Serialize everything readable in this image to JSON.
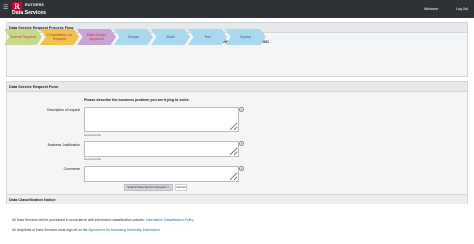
{
  "header": {
    "menu_icon": "hamburger-icon",
    "logo_letter": "R",
    "brand": "RUTGERS",
    "app_title": "Data Services",
    "nav": {
      "welcome": "Welcome",
      "logout": "Log Out"
    }
  },
  "process_panel": {
    "title": "Data Service Request Process Flow",
    "flow_title": "Data Service Request Process:",
    "steps": [
      {
        "label": "Submit Request",
        "state": "done"
      },
      {
        "label": "Consultation on Request",
        "state": "consult"
      },
      {
        "label": "Data Owner Approval",
        "state": "owner"
      },
      {
        "label": "Design",
        "state": "todo"
      },
      {
        "label": "Build",
        "state": "todo"
      },
      {
        "label": "Test",
        "state": "todo"
      },
      {
        "label": "Deploy",
        "state": "todo"
      }
    ],
    "colors": {
      "done": "#c9d98a",
      "consult": "#f1c24b",
      "owner": "#c9a2d6",
      "todo": "#a9d8f0"
    }
  },
  "form_panel": {
    "title": "Data Service Request Form",
    "instruction": "Please describe the business problem you are trying to solve.",
    "fields": {
      "description": {
        "label": "Description of request",
        "value": "",
        "required_note": "Required Field"
      },
      "justification": {
        "label": "Business Justification",
        "value": "",
        "required_note": "Required Field"
      },
      "comments": {
        "label": "Comments",
        "value": ""
      }
    },
    "submit_label": "Submit Data Service Request",
    "cancel_label": "Cancel"
  },
  "notice_panel": {
    "title": "Data Classification Notice",
    "line1_text": "All Data Services will be processed in accordance with information classification policies:",
    "line1_link": "Information Classification Policy",
    "line2_text": "All recipients of Data Services must sign off on the",
    "line2_link": "Agreement for Accessing University Information"
  }
}
